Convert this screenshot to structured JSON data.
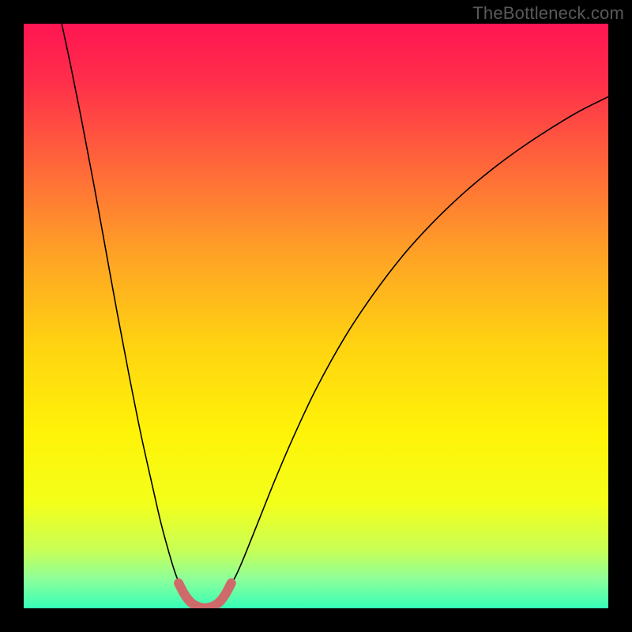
{
  "attribution": "TheBottleneck.com",
  "chart_data": {
    "type": "line",
    "title": "",
    "xlabel": "",
    "ylabel": "",
    "xlim": [
      0,
      100
    ],
    "ylim": [
      0,
      100
    ],
    "background_gradient": {
      "stops": [
        {
          "offset": 0.0,
          "color": "#ff1552"
        },
        {
          "offset": 0.1,
          "color": "#ff2f4a"
        },
        {
          "offset": 0.25,
          "color": "#ff6a39"
        },
        {
          "offset": 0.4,
          "color": "#ffa425"
        },
        {
          "offset": 0.55,
          "color": "#ffd311"
        },
        {
          "offset": 0.7,
          "color": "#fff308"
        },
        {
          "offset": 0.82,
          "color": "#f3ff1a"
        },
        {
          "offset": 0.9,
          "color": "#c8ff55"
        },
        {
          "offset": 0.95,
          "color": "#8dff9a"
        },
        {
          "offset": 1.0,
          "color": "#36ffb7"
        }
      ]
    },
    "series": [
      {
        "name": "bottleneck-curve",
        "color": "#000000",
        "width": 1.6,
        "points": [
          {
            "x": 6.5,
            "y": 100.0
          },
          {
            "x": 8.0,
            "y": 93.0
          },
          {
            "x": 10.0,
            "y": 83.0
          },
          {
            "x": 12.0,
            "y": 72.5
          },
          {
            "x": 14.0,
            "y": 61.5
          },
          {
            "x": 16.0,
            "y": 50.5
          },
          {
            "x": 18.0,
            "y": 40.0
          },
          {
            "x": 20.0,
            "y": 30.0
          },
          {
            "x": 22.0,
            "y": 21.0
          },
          {
            "x": 23.5,
            "y": 14.5
          },
          {
            "x": 25.0,
            "y": 9.0
          },
          {
            "x": 26.0,
            "y": 5.8
          },
          {
            "x": 27.0,
            "y": 3.4
          },
          {
            "x": 28.0,
            "y": 1.7
          },
          {
            "x": 29.0,
            "y": 0.7
          },
          {
            "x": 30.0,
            "y": 0.2
          },
          {
            "x": 31.0,
            "y": 0.0
          },
          {
            "x": 32.0,
            "y": 0.2
          },
          {
            "x": 33.0,
            "y": 0.7
          },
          {
            "x": 34.0,
            "y": 1.7
          },
          {
            "x": 35.0,
            "y": 3.2
          },
          {
            "x": 36.5,
            "y": 6.0
          },
          {
            "x": 38.0,
            "y": 9.5
          },
          {
            "x": 40.0,
            "y": 14.5
          },
          {
            "x": 43.0,
            "y": 22.0
          },
          {
            "x": 46.0,
            "y": 29.0
          },
          {
            "x": 50.0,
            "y": 37.5
          },
          {
            "x": 55.0,
            "y": 46.5
          },
          {
            "x": 60.0,
            "y": 54.0
          },
          {
            "x": 65.0,
            "y": 60.5
          },
          {
            "x": 70.0,
            "y": 66.0
          },
          {
            "x": 75.0,
            "y": 70.8
          },
          {
            "x": 80.0,
            "y": 75.0
          },
          {
            "x": 85.0,
            "y": 78.7
          },
          {
            "x": 90.0,
            "y": 82.0
          },
          {
            "x": 95.0,
            "y": 85.0
          },
          {
            "x": 100.0,
            "y": 87.5
          }
        ]
      },
      {
        "name": "optimal-highlight",
        "color": "#cf6a6a",
        "width": 12,
        "linecap": "round",
        "points": [
          {
            "x": 26.5,
            "y": 4.3
          },
          {
            "x": 27.5,
            "y": 2.4
          },
          {
            "x": 28.5,
            "y": 1.1
          },
          {
            "x": 29.5,
            "y": 0.4
          },
          {
            "x": 30.5,
            "y": 0.1
          },
          {
            "x": 31.5,
            "y": 0.1
          },
          {
            "x": 32.5,
            "y": 0.4
          },
          {
            "x": 33.5,
            "y": 1.1
          },
          {
            "x": 34.5,
            "y": 2.4
          },
          {
            "x": 35.5,
            "y": 4.3
          }
        ]
      }
    ]
  }
}
